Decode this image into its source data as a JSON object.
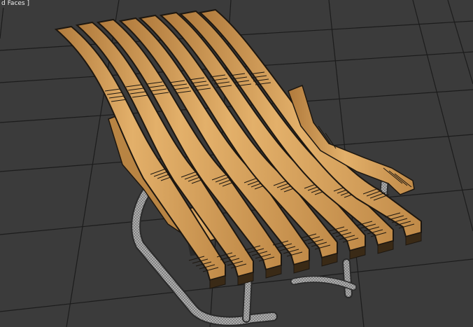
{
  "viewport": {
    "label": "d Faces ]",
    "colors": {
      "background": "#3b3b3b",
      "grid_line": "#1c1c1c",
      "wood_light": "#e0ab63",
      "wood_mid": "#c89353",
      "wood_dark": "#8d6230",
      "edge_line": "#1d1710",
      "frame_metal": "#9a9a9a"
    }
  },
  "scene": {
    "object": "lounge-chair",
    "slat_count": 8
  }
}
